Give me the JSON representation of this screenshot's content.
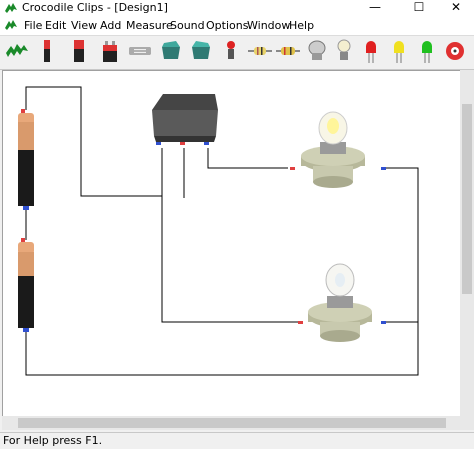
{
  "window": {
    "title": "Crocodile Clips - [Design1]",
    "minimize_glyph": "—",
    "maximize_glyph": "☐",
    "close_glyph": "✕"
  },
  "menu": {
    "items": [
      "File",
      "Edit",
      "View",
      "Add",
      "Measure",
      "Sound",
      "Options",
      "Window",
      "Help"
    ]
  },
  "toolbar": {
    "tools": [
      "crocodile-clip",
      "battery-cell",
      "battery-pack",
      "battery-9v",
      "fuse",
      "switch-green",
      "switch-teal",
      "push-switch",
      "resistor",
      "variable-resistor",
      "motor",
      "bulb",
      "led-red",
      "led-yellow",
      "led-green",
      "buzzer"
    ]
  },
  "canvas": {
    "components": [
      "cell-top",
      "cell-bottom",
      "rocker-switch",
      "bulb-upper",
      "bulb-lower"
    ]
  },
  "status": {
    "text": "For Help press F1."
  },
  "colors": {
    "croc_green": "#1a8a2a",
    "wire": "#000000",
    "cell_body": "#1a1a1a",
    "cell_cap": "#d99a6c"
  }
}
